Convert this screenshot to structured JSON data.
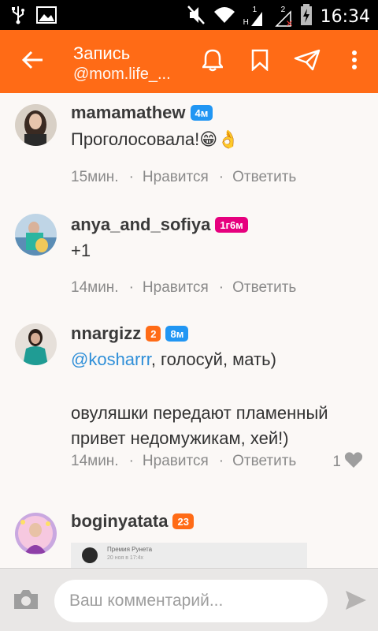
{
  "status_bar": {
    "time": "16:34",
    "sim1_label": "1",
    "sim2_label": "2",
    "network_letter": "H"
  },
  "header": {
    "title": "Запись",
    "subtitle": "@mom.life_..."
  },
  "comments": [
    {
      "username": "mamamathew",
      "badges": [
        {
          "text": "4м",
          "color": "blue"
        }
      ],
      "text": "Проголосовала!😁👌",
      "time": "15мин.",
      "like_label": "Нравится",
      "reply_label": "Ответить"
    },
    {
      "username": "anya_and_sofiya",
      "badges": [
        {
          "text": "1г6м",
          "color": "pink"
        }
      ],
      "text": "+1",
      "time": "14мин.",
      "like_label": "Нравится",
      "reply_label": "Ответить"
    },
    {
      "username": "nnargizz",
      "badges": [
        {
          "text": "2",
          "color": "orange"
        },
        {
          "text": "8м",
          "color": "blue"
        }
      ],
      "mention": "@kosharrr",
      "text_after_mention": ", голосуй, мать)",
      "text_line2": "овуляшки передают пламенный привет недомужикам, хей!)",
      "time": "14мин.",
      "like_label": "Нравится",
      "reply_label": "Ответить",
      "likes_count": "1"
    },
    {
      "username": "boginyatata",
      "badges": [
        {
          "text": "23",
          "color": "orange"
        }
      ],
      "preview_title": "Премия Рунета",
      "preview_sub": "20 ноя в 17:4x"
    }
  ],
  "input_bar": {
    "placeholder": "Ваш комментарий..."
  },
  "colors": {
    "accent": "#ff6b16",
    "mention": "#2f8fd8",
    "badge_blue": "#2196f3",
    "badge_pink": "#e6007e"
  }
}
